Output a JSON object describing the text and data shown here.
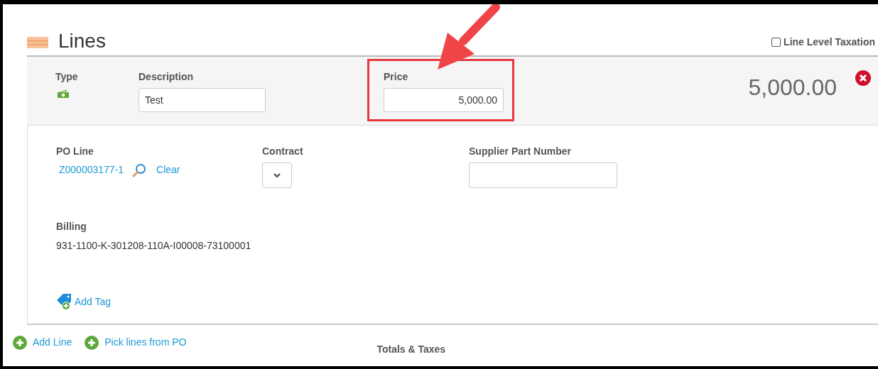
{
  "section": {
    "title": "Lines",
    "line_level_taxation": {
      "label": "Line Level Taxation",
      "checked": false
    }
  },
  "line": {
    "type_label": "Type",
    "description_label": "Description",
    "description": "Test",
    "price_label": "Price",
    "price": "5,000.00",
    "total": "5,000.00",
    "po_line_label": "PO Line",
    "po_line": "Z000003177-1",
    "clear": "Clear",
    "contract_label": "Contract",
    "supplier_part_label": "Supplier Part Number",
    "billing_label": "Billing",
    "billing": "931-1100-K-301208-110A-I00008-73100001",
    "add_tag": "Add Tag"
  },
  "footer": {
    "actions": [
      "Add Line",
      "Pick lines from PO"
    ],
    "totals": "Totals & Taxes"
  }
}
